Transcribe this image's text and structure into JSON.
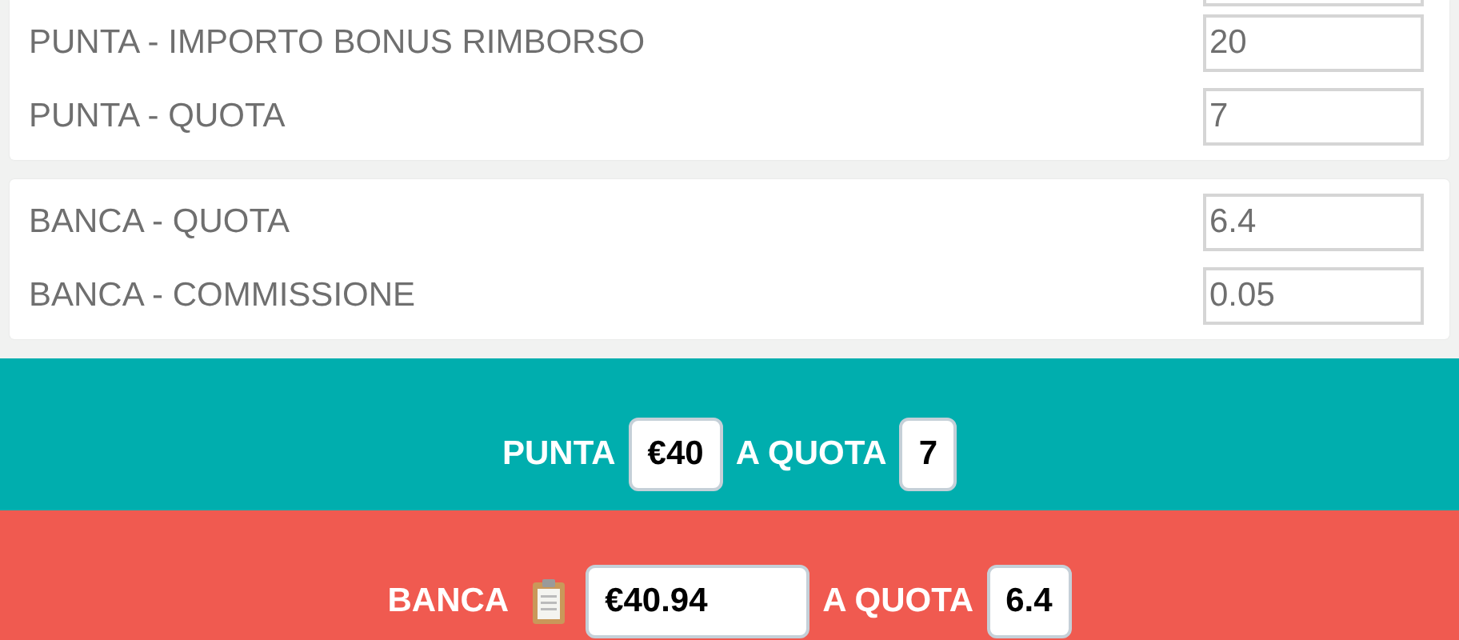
{
  "cards": [
    {
      "rows": [
        {
          "kind": "cut_field"
        },
        {
          "kind": "field",
          "label": "PUNTA - IMPORTO BONUS RIMBORSO",
          "value": "20"
        },
        {
          "kind": "field",
          "label": "PUNTA - QUOTA",
          "value": "7"
        }
      ]
    },
    {
      "rows": [
        {
          "kind": "field",
          "label": "BANCA - QUOTA",
          "value": "6.4"
        },
        {
          "kind": "field",
          "label": "BANCA - COMMISSIONE",
          "value": "0.05"
        }
      ]
    }
  ],
  "results": [
    {
      "kind": "back",
      "label": "PUNTA",
      "amount": "€40",
      "odds_label": "A QUOTA",
      "odds": "7"
    },
    {
      "kind": "lay",
      "label": "BANCA",
      "amount": "€40.94",
      "odds_label": "A QUOTA",
      "odds": "6.4"
    }
  ]
}
